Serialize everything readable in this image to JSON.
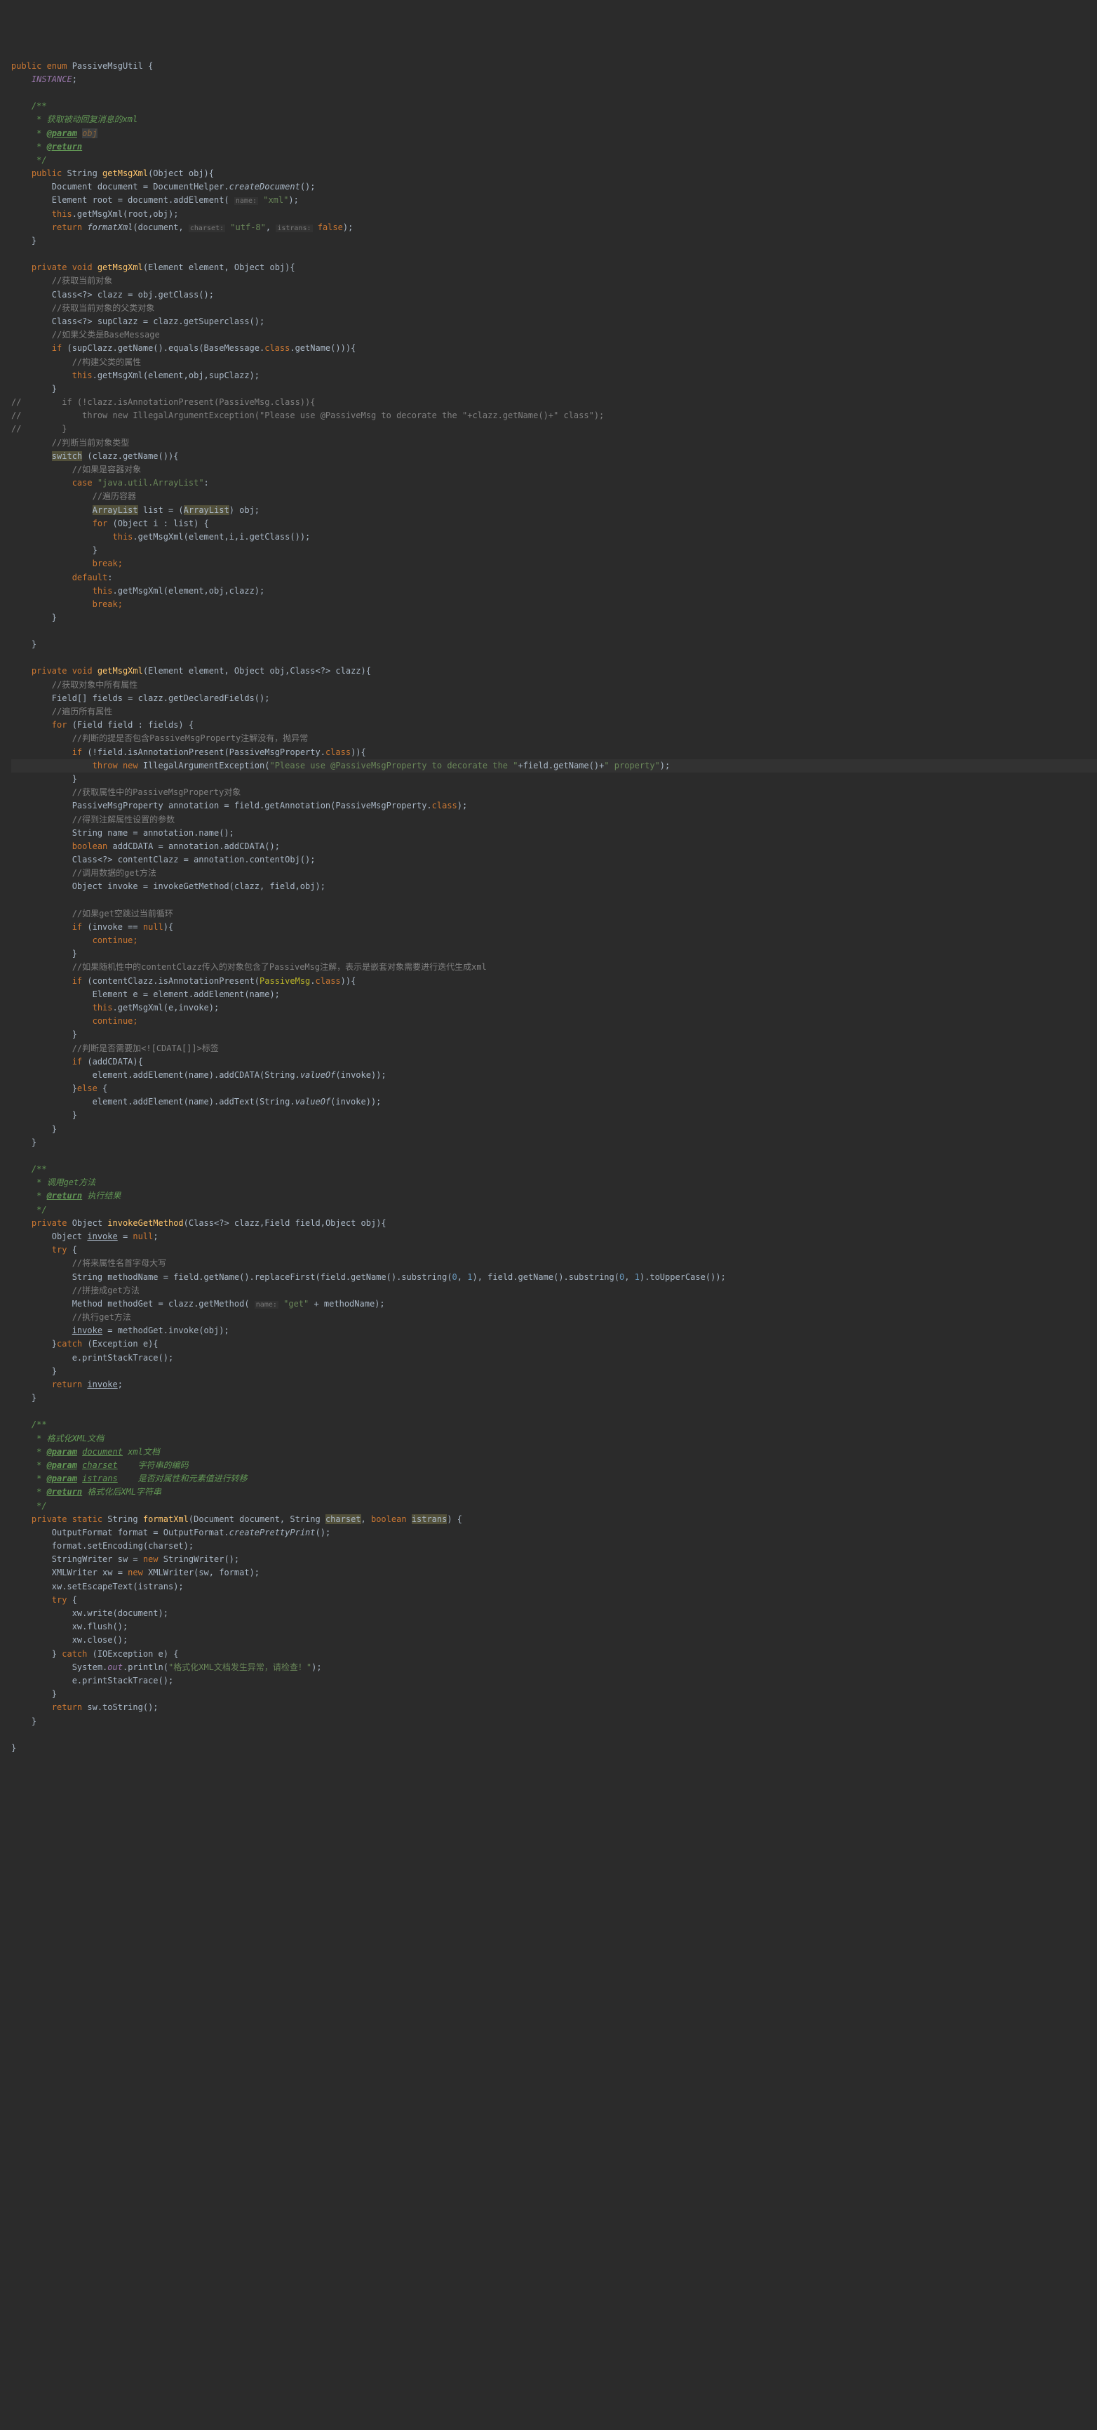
{
  "code": {
    "l1": "public enum",
    "l1b": " PassiveMsgUtil {",
    "l2a": "    ",
    "l2b": "INSTANCE",
    "l2c": ";",
    "l4": "    /**",
    "l5": "     * 获取被动回复消息的xml",
    "l6a": "     * ",
    "l6tag": "@param",
    "l6b": " ",
    "l6p": "obj",
    "l7a": "     * ",
    "l7tag": "@return",
    "l8": "     */",
    "l9a": "    public",
    "l9b": " String ",
    "l9c": "getMsgXml",
    "l9d": "(Object obj){",
    "l10a": "        Document document = DocumentHelper.",
    "l10b": "createDocument",
    "l10c": "();",
    "l11a": "        Element root = document.addElement( ",
    "l11h": "name:",
    "l11b": " ",
    "l11c": "\"xml\"",
    "l11d": ");",
    "l12a": "        ",
    "l12b": "this",
    "l12c": ".getMsgXml(root,obj);",
    "l13a": "        return ",
    "l13b": "formatXml",
    "l13c": "(document, ",
    "l13h1": "charset:",
    "l13d": " ",
    "l13e": "\"utf-8\"",
    "l13f": ", ",
    "l13h2": "istrans:",
    "l13g": " ",
    "l13i": "false",
    "l13j": ");",
    "l14": "    }",
    "l16a": "    private void ",
    "l16b": "getMsgXml",
    "l16c": "(Element element, Object obj){",
    "l17": "        //获取当前对象",
    "l18": "        Class<?> clazz = obj.getClass();",
    "l19": "        //获取当前对象的父类对象",
    "l20": "        Class<?> supClazz = clazz.getSuperclass();",
    "l21": "        //如果父类是BaseMessage",
    "l22a": "        if",
    "l22b": " (supClazz.getName().equals(BaseMessage.",
    "l22c": "class",
    "l22d": ".getName())){",
    "l23": "            //构建父类的属性",
    "l24a": "            ",
    "l24b": "this",
    "l24c": ".getMsgXml(element,obj,supClazz);",
    "l25": "        }",
    "l26": "//        if (!clazz.isAnnotationPresent(PassiveMsg.class)){",
    "l27": "//            throw new IllegalArgumentException(\"Please use @PassiveMsg to decorate the \"+clazz.getName()+\" class\");",
    "l28": "//        }",
    "l29": "        //判断当前对象类型",
    "l30a": "        ",
    "l30b": "switch",
    "l30c": " (clazz.getName()){",
    "l31": "            //如果是容器对象",
    "l32a": "            case ",
    "l32b": "\"java.util.ArrayList\"",
    "l32c": ":",
    "l33": "                //遍历容器",
    "l34a": "                ",
    "l34b": "ArrayList",
    "l34c": " list = (",
    "l34d": "ArrayList",
    "l34e": ") obj;",
    "l35a": "                for",
    "l35b": " (Object i : list) {",
    "l36a": "                    ",
    "l36b": "this",
    "l36c": ".getMsgXml(element,i,i.getClass());",
    "l37": "                }",
    "l38a": "                ",
    "l38b": "break;",
    "l39a": "            ",
    "l39b": "default",
    "l39c": ":",
    "l40a": "                ",
    "l40b": "this",
    "l40c": ".getMsgXml(element,obj,clazz);",
    "l41a": "                ",
    "l41b": "break;",
    "l42": "        }",
    "l44": "    }",
    "l46a": "    private void ",
    "l46b": "getMsgXml",
    "l46c": "(Element element, Object obj,Class<?> clazz){",
    "l47": "        //获取对象中所有属性",
    "l48": "        Field[] fields = clazz.getDeclaredFields();",
    "l49": "        //遍历所有属性",
    "l50a": "        for",
    "l50b": " (Field field : fields) {",
    "l51": "            //判断的提是否包含PassiveMsgProperty注解没有，抛异常",
    "l52a": "            if",
    "l52b": " (!field.isAnnotationPresent(PassiveMsgProperty.",
    "l52c": "class",
    "l52d": ")){",
    "l53a": "                throw new",
    "l53b": " IllegalArgumentException(",
    "l53c": "\"Please use @PassiveMsgProperty to decorate the \"",
    "l53d": "+field.getName()+",
    "l53e": "\" property\"",
    "l53f": ");",
    "l54": "            }",
    "l55": "            //获取属性中的PassiveMsgProperty对象",
    "l56a": "            PassiveMsgProperty annotation = field.getAnnotation(PassiveMsgProperty.",
    "l56b": "class",
    "l56c": ");",
    "l57": "            //得到注解属性设置的参数",
    "l58": "            String name = annotation.name();",
    "l59a": "            ",
    "l59b": "boolean",
    "l59c": " addCDATA = annotation.addCDATA();",
    "l60": "            Class<?> contentClazz = annotation.contentObj();",
    "l61": "            //调用数据的get方法",
    "l62": "            Object invoke = invokeGetMethod(clazz, field,obj);",
    "l64": "            //如果get空跳过当前循环",
    "l65a": "            if",
    "l65b": " (invoke == ",
    "l65c": "null",
    "l65d": "){",
    "l66a": "                ",
    "l66b": "continue;",
    "l67": "            }",
    "l68": "            //如果随机性中的contentClazz传入的对象包含了PassiveMsg注解，表示是嵌套对象需要进行迭代生成xml",
    "l69a": "            if",
    "l69b": " (contentClazz.isAnnotationPresent(",
    "l69c": "PassiveMsg",
    "l69d": ".",
    "l69e": "class",
    "l69f": ")){",
    "l70": "                Element e = element.addElement(name);",
    "l71a": "                ",
    "l71b": "this",
    "l71c": ".getMsgXml(e,invoke);",
    "l72a": "                ",
    "l72b": "continue;",
    "l73": "            }",
    "l74": "            //判断是否需要加<![CDATA[]]>标签",
    "l75a": "            if",
    "l75b": " (addCDATA){",
    "l76a": "                element.addElement(name).addCDATA(String.",
    "l76b": "valueOf",
    "l76c": "(invoke));",
    "l77a": "            }",
    "l77b": "else",
    "l77c": " {",
    "l78a": "                element.addElement(name).addText(String.",
    "l78b": "valueOf",
    "l78c": "(invoke));",
    "l79": "            }",
    "l80": "        }",
    "l81": "    }",
    "l83": "    /**",
    "l84": "     * 调用get方法",
    "l85a": "     * ",
    "l85tag": "@return",
    "l85b": " 执行结果",
    "l86": "     */",
    "l87a": "    private",
    "l87b": " Object ",
    "l87c": "invokeGetMethod",
    "l87d": "(Class<?> clazz,Field field,Object obj){",
    "l88a": "        Object ",
    "l88b": "invoke",
    "l88c": " = ",
    "l88d": "null",
    "l88e": ";",
    "l89a": "        try",
    "l89b": " {",
    "l90": "            //将来属性名首字母大写",
    "l91a": "            String methodName = field.getName().replaceFirst(field.getName().substring(",
    "l91b": "0",
    "l91c": ", ",
    "l91d": "1",
    "l91e": "), field.getName().substring(",
    "l91f": "0",
    "l91g": ", ",
    "l91h": "1",
    "l91i": ").toUpperCase());",
    "l92": "            //拼接成get方法",
    "l93a": "            Method methodGet = clazz.getMethod( ",
    "l93h": "name:",
    "l93b": " ",
    "l93c": "\"get\"",
    "l93d": " + methodName);",
    "l94": "            //执行get方法",
    "l95a": "            ",
    "l95b": "invoke",
    "l95c": " = methodGet.invoke(obj);",
    "l96a": "        }",
    "l96b": "catch",
    "l96c": " (Exception e){",
    "l97": "            e.printStackTrace();",
    "l98": "        }",
    "l99a": "        return ",
    "l99b": "invoke",
    "l99c": ";",
    "l100": "    }",
    "l102": "    /**",
    "l103": "     * 格式化XML文档",
    "l104a": "     * ",
    "l104tag": "@param",
    "l104b": " ",
    "l104p": "document",
    "l104c": " xml文档",
    "l105a": "     * ",
    "l105tag": "@param",
    "l105b": " ",
    "l105p": "charset",
    "l105c": "    字符串的编码",
    "l106a": "     * ",
    "l106tag": "@param",
    "l106b": " ",
    "l106p": "istrans",
    "l106c": "    是否对属性和元素值进行转移",
    "l107a": "     * ",
    "l107tag": "@return",
    "l107b": " 格式化后XML字符串",
    "l108": "     */",
    "l109a": "    private static",
    "l109b": " String ",
    "l109c": "formatXml",
    "l109d": "(Document document, String ",
    "l109e": "charset",
    "l109f": ", ",
    "l109g": "boolean ",
    "l109h": "istrans",
    "l109i": ") {",
    "l110a": "        OutputFormat format = OutputFormat.",
    "l110b": "createPrettyPrint",
    "l110c": "();",
    "l111": "        format.setEncoding(charset);",
    "l112a": "        StringWriter sw = ",
    "l112b": "new",
    "l112c": " StringWriter();",
    "l113a": "        XMLWriter xw = ",
    "l113b": "new",
    "l113c": " XMLWriter(sw, format);",
    "l114": "        xw.setEscapeText(istrans);",
    "l115a": "        try",
    "l115b": " {",
    "l116": "            xw.write(document);",
    "l117": "            xw.flush();",
    "l118": "            xw.close();",
    "l119a": "        } ",
    "l119b": "catch",
    "l119c": " (IOException e) {",
    "l120a": "            System.",
    "l120b": "out",
    "l120c": ".println(",
    "l120d": "\"格式化XML文档发生异常，请检查！\"",
    "l120e": ");",
    "l121": "            e.printStackTrace();",
    "l122": "        }",
    "l123a": "        return",
    "l123b": " sw.toString();",
    "l124": "    }",
    "l126": "}"
  }
}
